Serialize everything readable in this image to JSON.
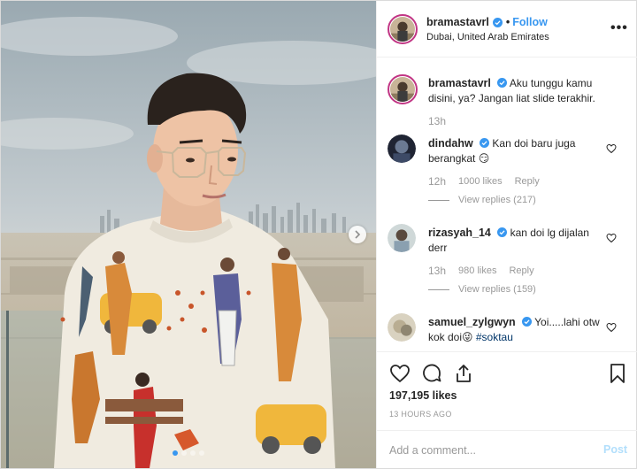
{
  "post": {
    "username": "bramastavrl",
    "follow_label": "Follow",
    "separator": "•",
    "location": "Dubai, United Arab Emirates",
    "more_label": "•••"
  },
  "caption": {
    "username": "bramastavrl",
    "text": "Aku tunggu kamu disini, ya? Jangan liat slide terakhir.",
    "time": "13h"
  },
  "comments": [
    {
      "username": "dindahw",
      "text": "Kan doi baru juga berangkat 😏",
      "time": "12h",
      "likes": "1000 likes",
      "reply_label": "Reply",
      "view_replies": "View replies (217)"
    },
    {
      "username": "rizasyah_14",
      "text": "kan doi lg dijalan derr",
      "time": "13h",
      "likes": "980 likes",
      "reply_label": "Reply",
      "view_replies": "View replies (159)"
    },
    {
      "username": "samuel_zylgwyn",
      "text": "Yoi.....lahi otw kok doi😜",
      "hashtag": "#soktau"
    }
  ],
  "actions": {
    "likes": "197,195 likes",
    "posted_time": "13 HOURS AGO",
    "comment_placeholder": "Add a comment...",
    "post_label": "Post"
  },
  "carousel": {
    "slides": 4,
    "active": 0
  },
  "icons": {
    "verified": "verified-badge-icon",
    "next": "chevron-right-icon",
    "like": "heart-icon",
    "comment": "comment-bubble-icon",
    "share": "share-upload-icon",
    "save": "bookmark-icon"
  },
  "colors": {
    "accent": "#3897f0",
    "post_disabled": "#b2dffc",
    "meta_gray": "#999999",
    "avatar_ring": "#c13584"
  }
}
